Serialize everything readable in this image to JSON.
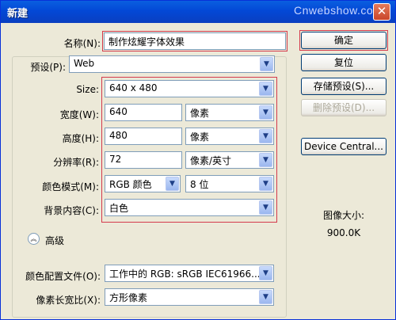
{
  "titlebar": {
    "title": "新建",
    "watermark": "Cnwebshow.com",
    "close_glyph": "✕"
  },
  "form": {
    "name": {
      "label": "名称(N):",
      "value": "制作炫耀字体效果"
    },
    "preset": {
      "label": "预设(P):",
      "value": "Web"
    },
    "size": {
      "label": "Size:",
      "value": "640 x 480"
    },
    "width": {
      "label": "宽度(W):",
      "value": "640",
      "unit": "像素"
    },
    "height": {
      "label": "高度(H):",
      "value": "480",
      "unit": "像素"
    },
    "resolution": {
      "label": "分辨率(R):",
      "value": "72",
      "unit": "像素/英寸"
    },
    "color_mode": {
      "label": "颜色模式(M):",
      "value": "RGB 颜色",
      "depth": "8 位"
    },
    "background": {
      "label": "背景内容(C):",
      "value": "白色"
    },
    "advanced": {
      "label": "高级"
    },
    "color_profile": {
      "label": "颜色配置文件(O):",
      "value": "工作中的 RGB: sRGB IEC61966..."
    },
    "pixel_aspect": {
      "label": "像素长宽比(X):",
      "value": "方形像素"
    }
  },
  "buttons": {
    "ok": "确定",
    "reset": "复位",
    "save_preset": "存储预设(S)...",
    "delete_preset": "删除预设(D)...",
    "device_central": "Device Central..."
  },
  "image_size": {
    "label": "图像大小:",
    "value": "900.0K"
  },
  "icons": {
    "dropdown": "dropdown-arrow-icon",
    "collapse": "collapse-up-icon",
    "close": "close-icon"
  }
}
